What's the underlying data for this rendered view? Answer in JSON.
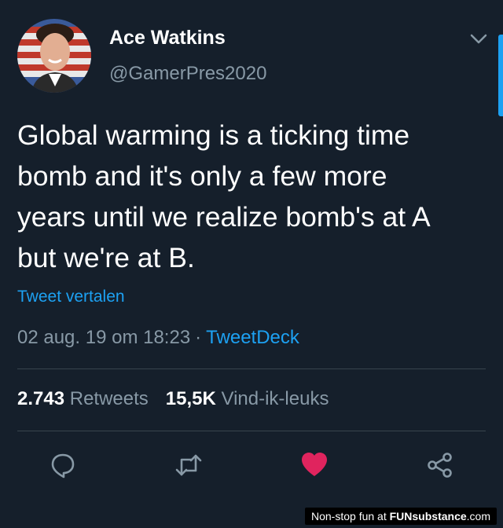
{
  "user": {
    "name": "Ace Watkins",
    "handle": "@GamerPres2020"
  },
  "tweet": {
    "text": "Global warming is a ticking time\nbomb and it's only a few more\nyears until we realize bomb's at A\nbut we're at B.",
    "translate_label": "Tweet vertalen",
    "timestamp": "02 aug. 19 om 18:23",
    "separator": "·",
    "source": "TweetDeck"
  },
  "stats": {
    "retweets_count": "2.743",
    "retweets_label": "Retweets",
    "likes_count": "15,5K",
    "likes_label": "Vind-ik-leuks"
  },
  "actions": {
    "reply_icon": "reply-icon",
    "retweet_icon": "retweet-icon",
    "like_icon": "heart-icon",
    "share_icon": "share-icon"
  },
  "watermark": {
    "prefix": "Non-stop fun at",
    "brand": "FUNsubstance",
    "suffix": ".com"
  },
  "colors": {
    "background": "#151f2b",
    "accent": "#1da1f2",
    "muted": "#8899a6",
    "like": "#e0245e"
  }
}
